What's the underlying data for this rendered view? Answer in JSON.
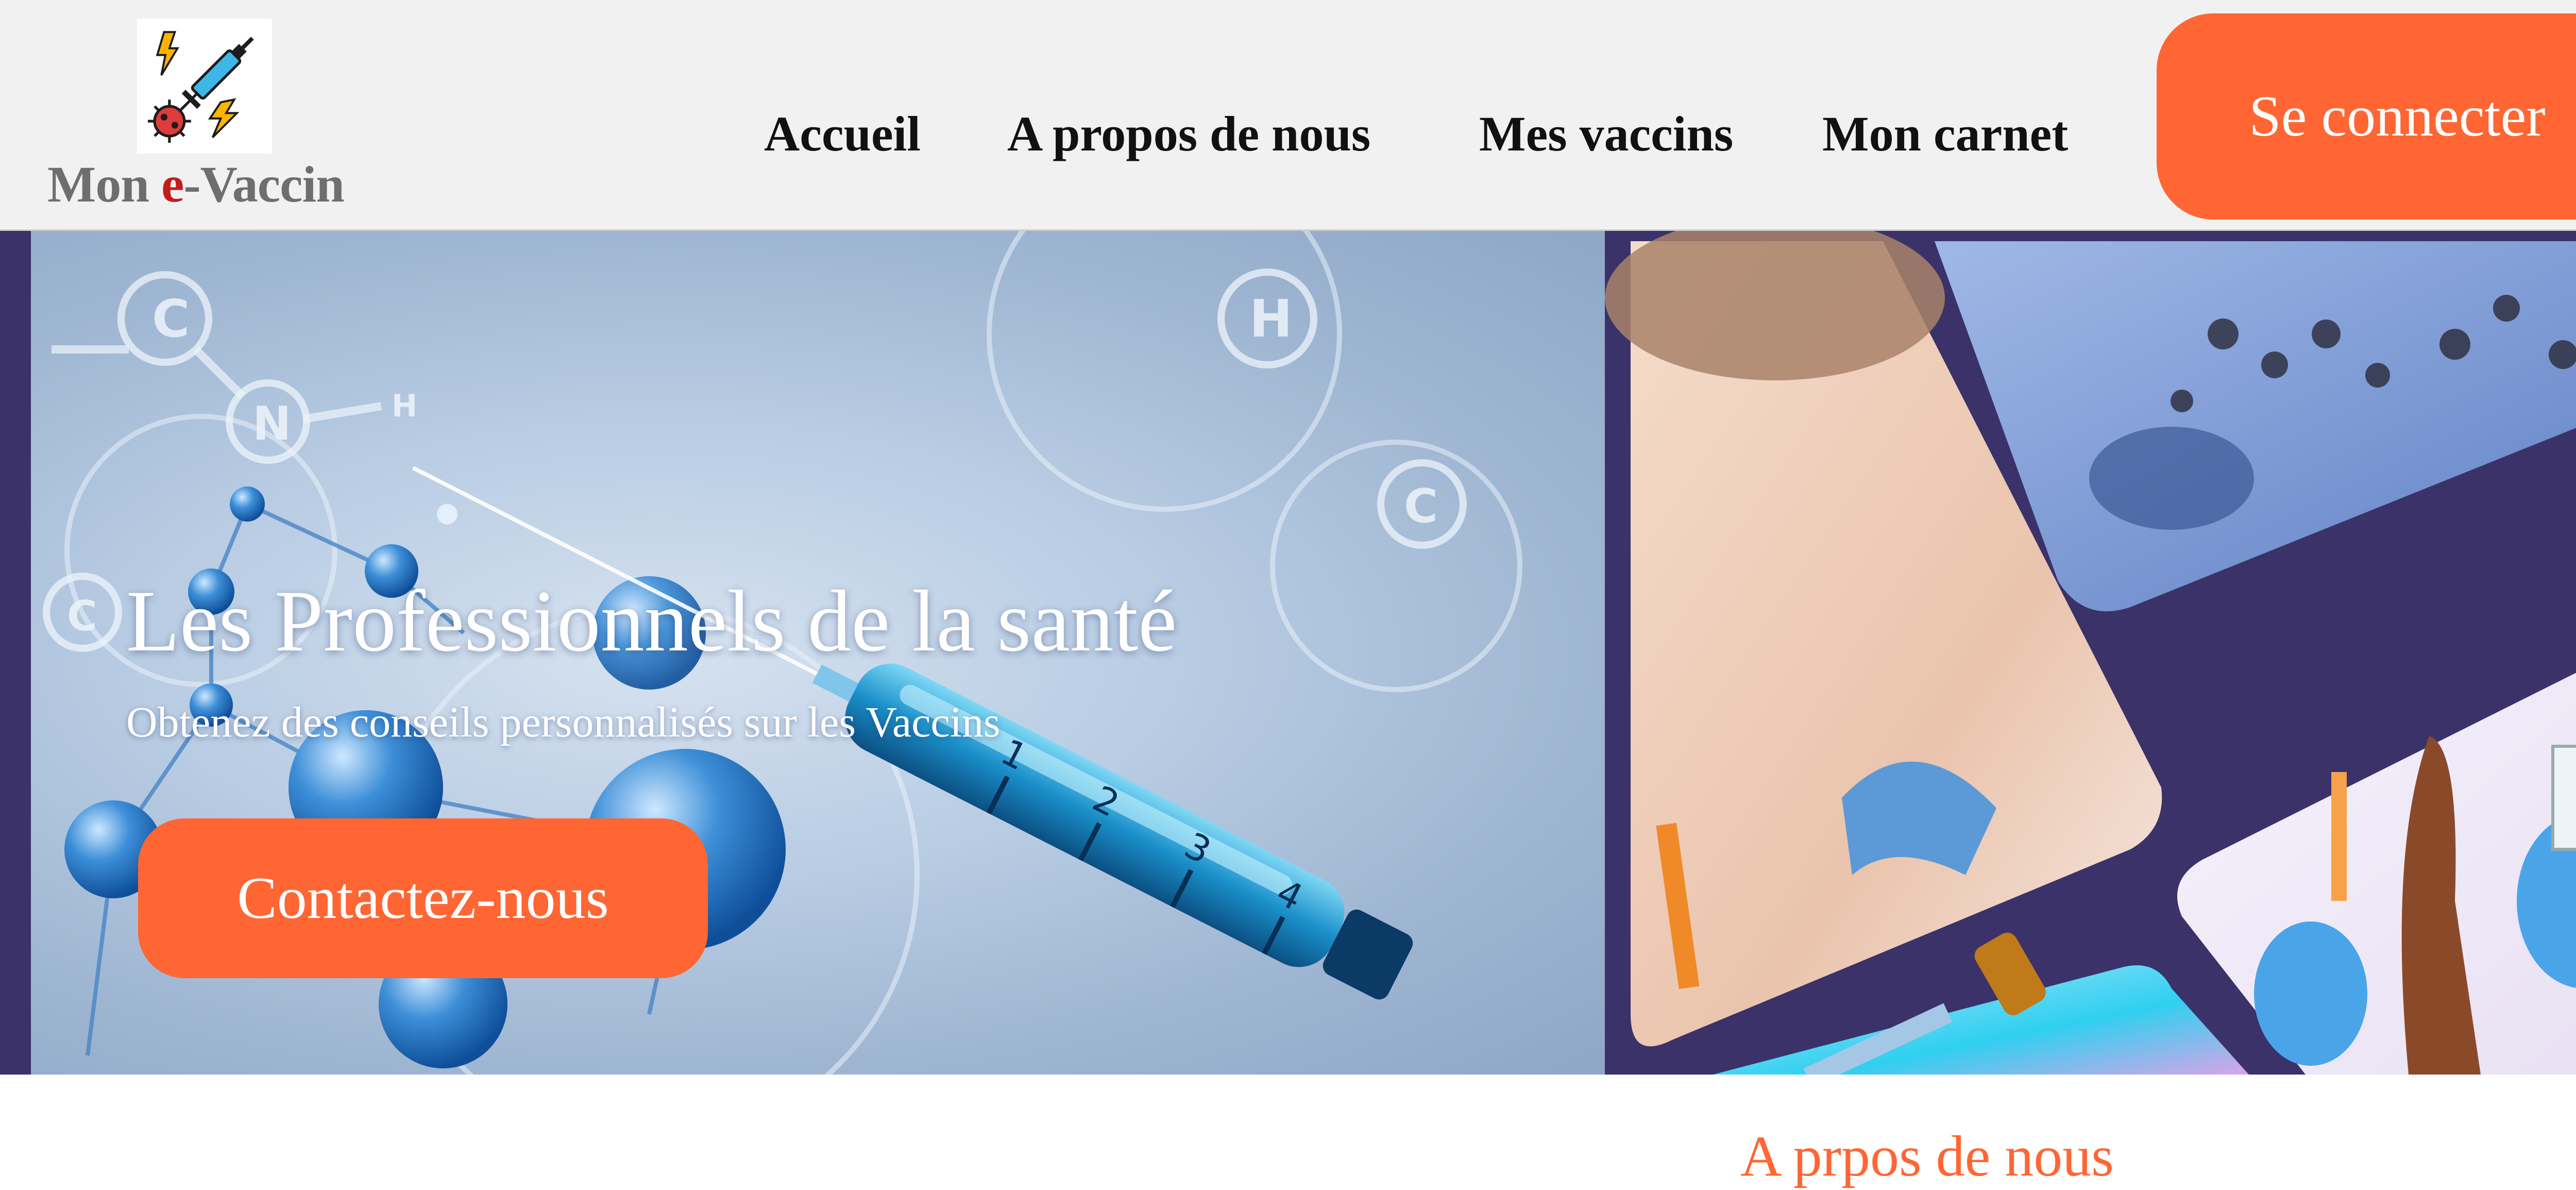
{
  "brand": {
    "name_prefix": "Mon ",
    "name_accent": "e",
    "name_suffix": "-Vaccin",
    "accent_color": "#c61b1b"
  },
  "nav": {
    "items": [
      {
        "label": "Accueil"
      },
      {
        "label": "A propos de nous"
      },
      {
        "label": "Mes vaccins"
      },
      {
        "label": "Mon carnet"
      }
    ],
    "login_button": "Se connecter"
  },
  "hero": {
    "title": "Les Professionnels de la santé",
    "subtitle": "Obtenez des conseils personnalisés sur les Vaccins",
    "cta_button": "Contactez-nous"
  },
  "about": {
    "title": "A prpos de nous"
  },
  "colors": {
    "primary": "#ff6633",
    "hero_frame": "#3a3268",
    "header_bg": "#f1f1f1"
  },
  "icons": [
    "vaccine-logo-icon",
    "syringe-icon",
    "virus-icon",
    "lightning-icon"
  ]
}
